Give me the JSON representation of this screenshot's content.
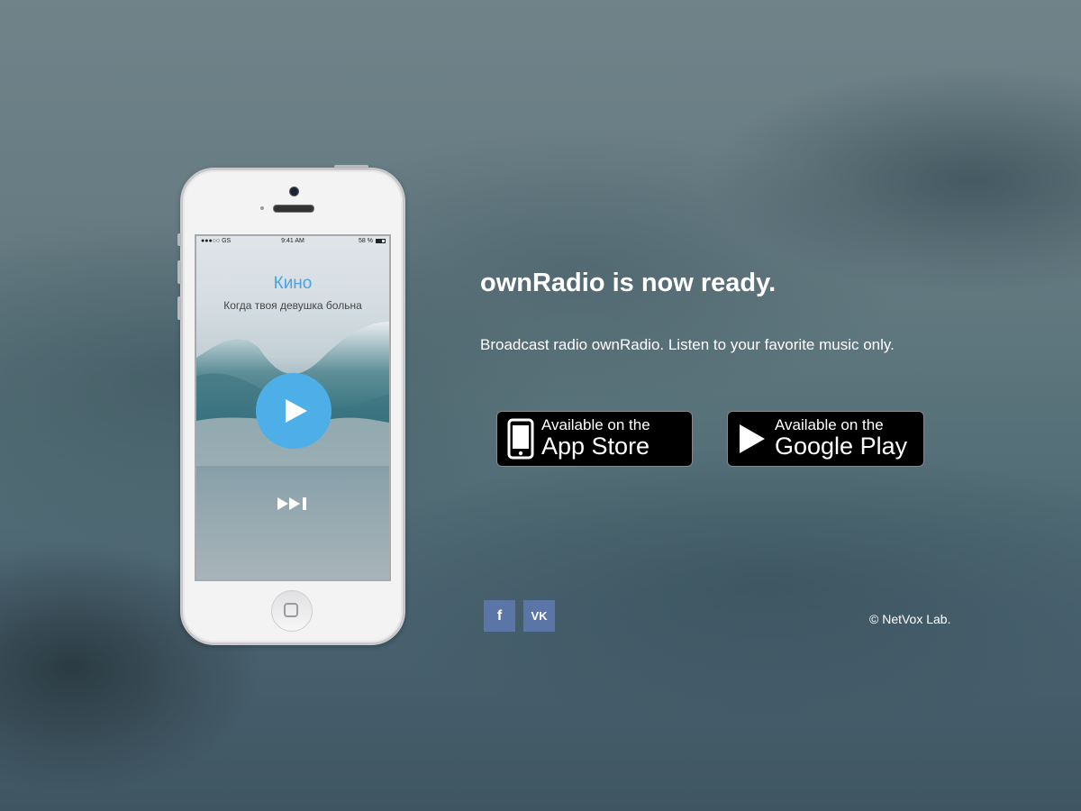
{
  "phone": {
    "status": {
      "carrier": "●●●○○ GS",
      "time": "9:41 AM",
      "battery": "58 %"
    },
    "player": {
      "artist": "Кино",
      "title": "Когда твоя девушка больна",
      "play_icon": "play-icon",
      "next_icon": "next-track-icon",
      "accent_color": "#4daee8"
    }
  },
  "main": {
    "headline": "ownRadio is now ready.",
    "subtitle": "Broadcast radio ownRadio. Listen to your favorite music only."
  },
  "stores": {
    "appstore": {
      "small": "Available on the",
      "big": "App Store",
      "icon": "phone-icon"
    },
    "googleplay": {
      "small": "Available on the",
      "big": "Google Play",
      "icon": "play-triangle-icon"
    }
  },
  "social": {
    "facebook": {
      "label": "f",
      "icon": "facebook-icon"
    },
    "vk": {
      "label": "VK",
      "icon": "vk-icon"
    }
  },
  "footer": {
    "copyright": "© NetVox Lab."
  }
}
